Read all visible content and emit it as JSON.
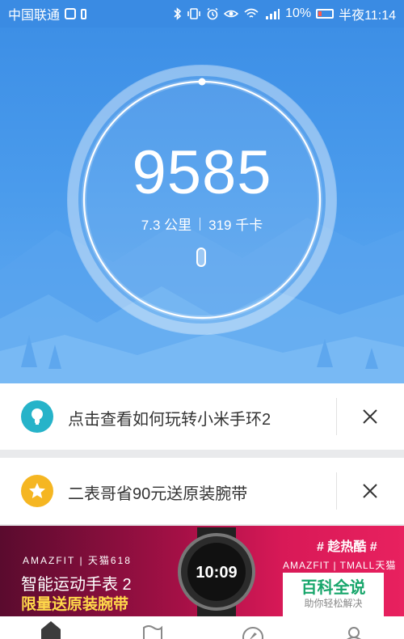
{
  "status_bar": {
    "carrier": "中国联通",
    "battery_percent": "10%",
    "time": "半夜11:14",
    "icons": [
      "notification-icon",
      "phone-icon",
      "bluetooth-icon",
      "vibrate-icon",
      "alarm-icon",
      "eye-icon",
      "wifi-icon",
      "signal-icon",
      "battery-icon"
    ]
  },
  "hero": {
    "steps": "9585",
    "distance": "7.3 公里",
    "calories": "319 千卡",
    "colors": {
      "background": "#4a9bec",
      "ring": "#ffffff"
    }
  },
  "cards": [
    {
      "text": "点击查看如何玩转小米手环2",
      "icon": "lightbulb-icon",
      "icon_color": "#26b3c9"
    },
    {
      "text": "二表哥省90元送原装腕带",
      "icon": "star-icon",
      "icon_color": "#f5b622"
    }
  ],
  "banner": {
    "brand": "AMAZFIT | 天猫618",
    "title": "智能运动手表 2",
    "promo": "限量送原装腕带",
    "watch_time": "10:09",
    "tag": "# 趁热酷 #",
    "tmall": "AMAZFIT | TMALL天猫",
    "baike_title": "百科全说",
    "baike_sub": "助你轻松解决"
  },
  "bottom_nav": [
    "home-icon",
    "flag-icon",
    "compass-icon",
    "profile-icon"
  ]
}
